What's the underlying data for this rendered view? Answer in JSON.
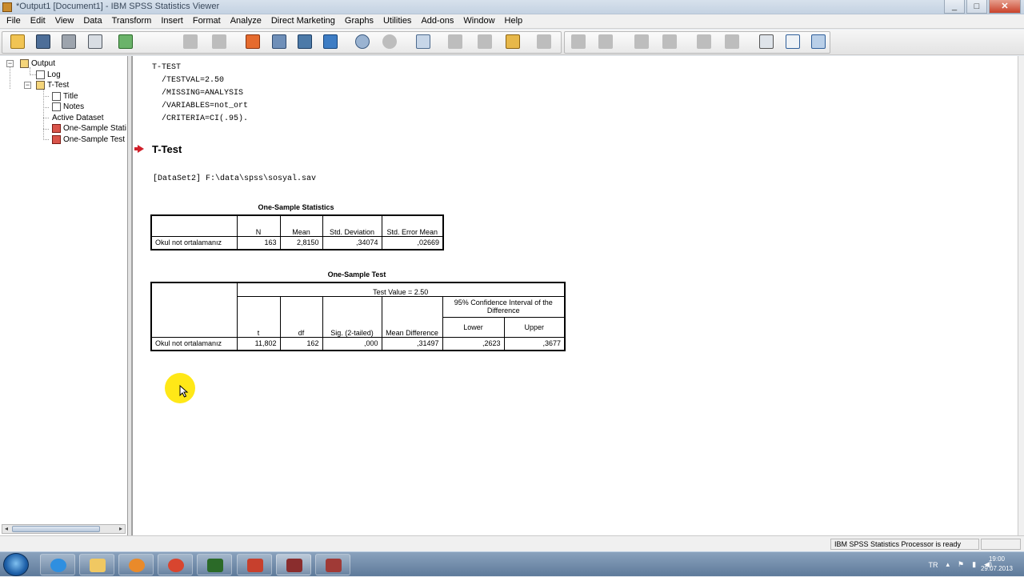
{
  "window": {
    "title": "*Output1 [Document1] - IBM SPSS Statistics Viewer"
  },
  "menu": [
    "File",
    "Edit",
    "View",
    "Data",
    "Transform",
    "Insert",
    "Format",
    "Analyze",
    "Direct Marketing",
    "Graphs",
    "Utilities",
    "Add-ons",
    "Window",
    "Help"
  ],
  "tree": {
    "output": "Output",
    "log": "Log",
    "ttest": "T-Test",
    "title": "Title",
    "notes": "Notes",
    "active_dataset": "Active Dataset",
    "one_sample_stats": "One-Sample Stati",
    "one_sample_test": "One-Sample Test"
  },
  "syntax": {
    "line1": "T-TEST",
    "line2": "  /TESTVAL=2.50",
    "line3": "  /MISSING=ANALYSIS",
    "line4": "  /VARIABLES=not_ort",
    "line5": "  /CRITERIA=CI(.95)."
  },
  "heading": "T-Test",
  "dataset": "[DataSet2] F:\\data\\spss\\sosyal.sav",
  "stats_table": {
    "title": "One-Sample Statistics",
    "headers": [
      "N",
      "Mean",
      "Std. Deviation",
      "Std. Error Mean"
    ],
    "row_label": "Okul not ortalamanız",
    "values": [
      "163",
      "2,8150",
      ",34074",
      ",02669"
    ]
  },
  "test_table": {
    "title": "One-Sample Test",
    "test_value": "Test Value = 2.50",
    "ci_header": "95% Confidence Interval of the Difference",
    "headers": [
      "t",
      "df",
      "Sig. (2-tailed)",
      "Mean Difference",
      "Lower",
      "Upper"
    ],
    "row_label": "Okul not ortalamanız",
    "values": [
      "11,802",
      "162",
      ",000",
      ",31497",
      ",2623",
      ",3677"
    ]
  },
  "status": {
    "processor": "IBM SPSS Statistics Processor is ready"
  },
  "taskbar": {
    "lang": "TR",
    "time": "19:00",
    "date": "29.07.2013"
  },
  "colors": {
    "accent": "#d0202a",
    "tree_folder": "#f5d57a",
    "highlight": "#ffe817"
  }
}
